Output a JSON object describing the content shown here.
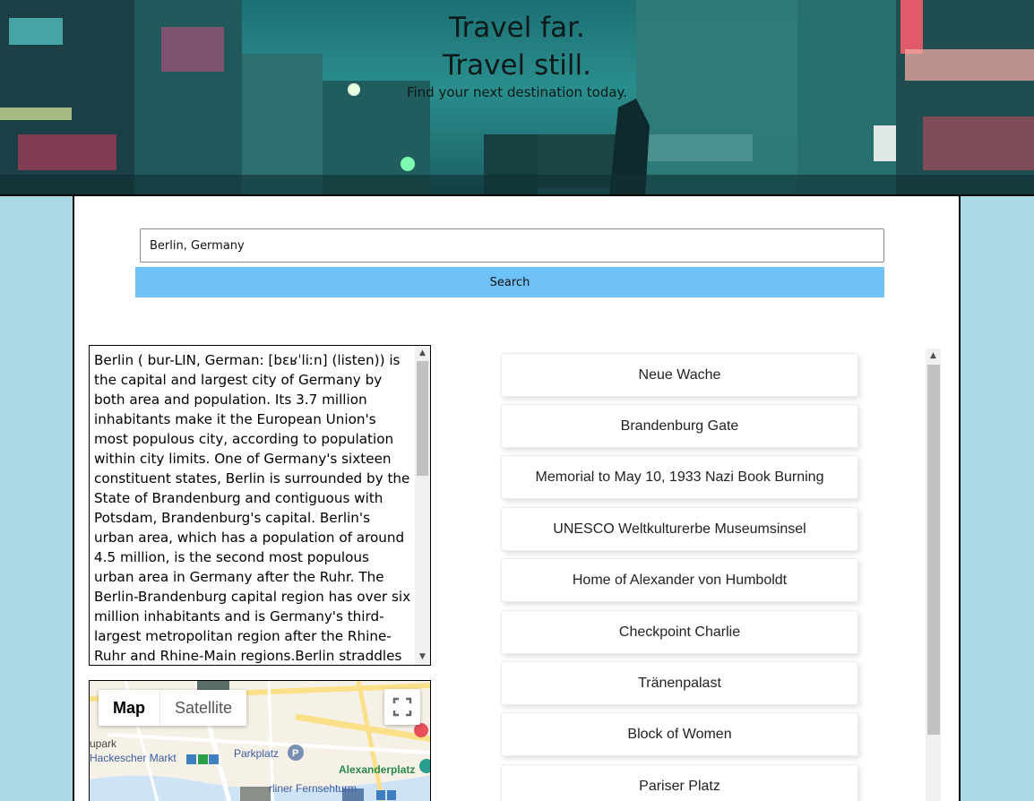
{
  "hero": {
    "title_line1": "Travel far.",
    "title_line2": "Travel still.",
    "subtitle": "Find your next destination today.",
    "background_color": "#2a8e8d"
  },
  "search": {
    "value": "Berlin, Germany",
    "button_label": "Search",
    "button_color": "#6ec2f7"
  },
  "description": {
    "text": "Berlin ( bur-LIN, German: [bɛʁˈliːn] (listen)) is the capital and largest city of Germany by both area and population. Its 3.7 million inhabitants make it the European Union's most populous city, according to population within city limits. One of Germany's sixteen constituent states, Berlin is surrounded by the State of Brandenburg and contiguous with Potsdam, Brandenburg's capital. Berlin's urban area, which has a population of around 4.5 million, is the second most populous urban area in Germany after the Ruhr. The Berlin-Brandenburg capital region has over six million inhabitants and is Germany's third-largest metropolitan region after the Rhine-Ruhr and Rhine-Main regions.Berlin straddles the banks"
  },
  "map": {
    "tab_map": "Map",
    "tab_satellite": "Satellite",
    "labels": {
      "parkplatz": "Parkplatz",
      "alexanderplatz": "Alexanderplatz",
      "hackescher": "Hackescher Markt",
      "upark": "upark",
      "fernsehturm": "rliner Fernsehturm"
    }
  },
  "attractions": [
    "Neue Wache",
    "Brandenburg Gate",
    "Memorial to May 10, 1933 Nazi Book Burning",
    "UNESCO Weltkulturerbe Museumsinsel",
    "Home of Alexander von Humboldt",
    "Checkpoint Charlie",
    "Tränenpalast",
    "Block of Women",
    "Pariser Platz"
  ],
  "colors": {
    "page_background": "#add8e6",
    "panel_background": "#ffffff"
  }
}
